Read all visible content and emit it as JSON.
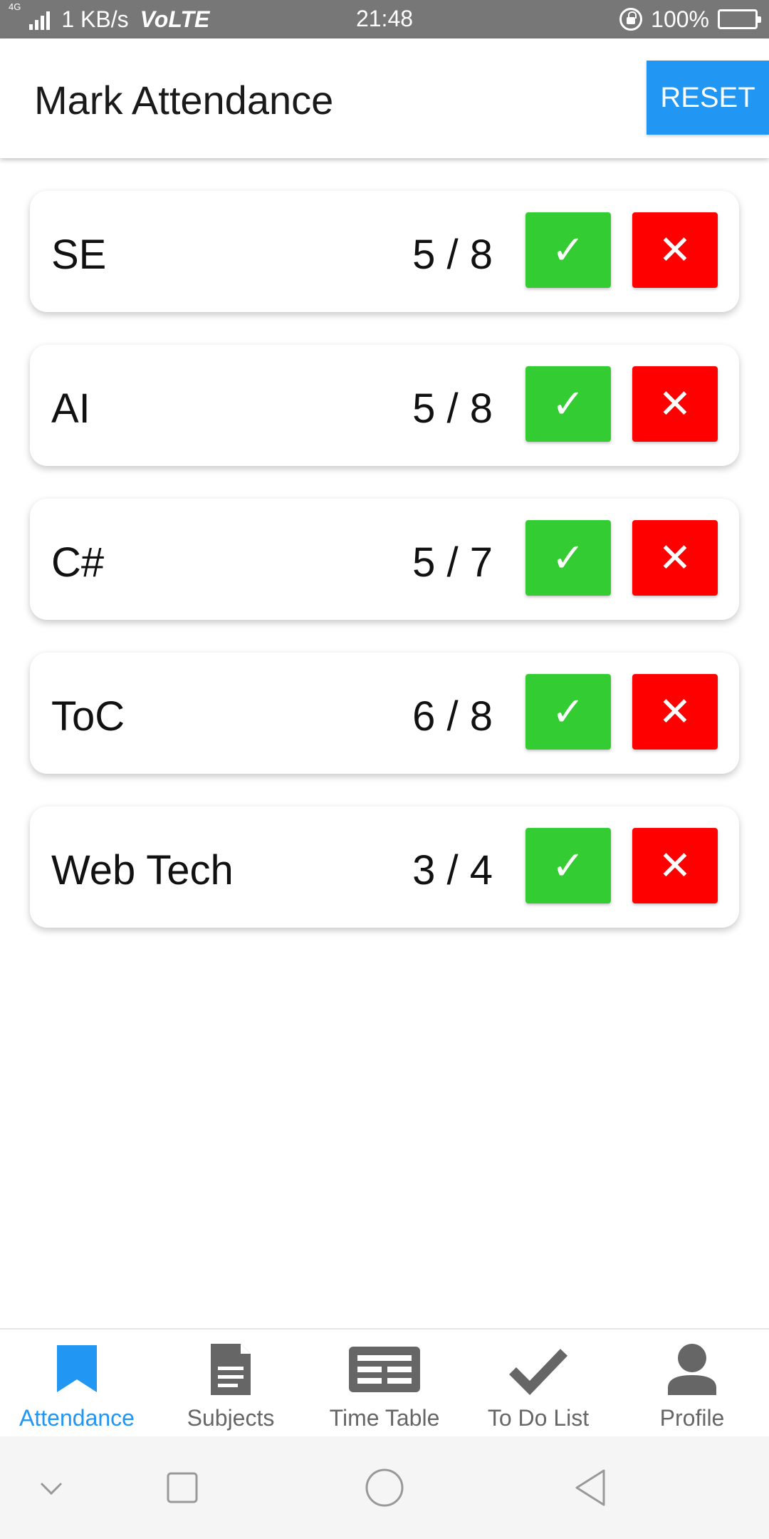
{
  "status_bar": {
    "network": "4G",
    "speed": "1 KB/s",
    "volte": "VoLTE",
    "time": "21:48",
    "battery": "100%"
  },
  "header": {
    "title": "Mark Attendance",
    "reset_label": "RESET"
  },
  "subjects": [
    {
      "name": "SE",
      "count": "5 / 8",
      "present_symbol": "✓",
      "absent_symbol": "✕"
    },
    {
      "name": "AI",
      "count": "5 / 8",
      "present_symbol": "✓",
      "absent_symbol": "✕"
    },
    {
      "name": "C#",
      "count": "5 / 7",
      "present_symbol": "✓",
      "absent_symbol": "✕"
    },
    {
      "name": "ToC",
      "count": "6 / 8",
      "present_symbol": "✓",
      "absent_symbol": "✕"
    },
    {
      "name": "Web Tech",
      "count": "3 / 4",
      "present_symbol": "✓",
      "absent_symbol": "✕"
    }
  ],
  "bottom_nav": [
    {
      "label": "Attendance",
      "icon": "bookmark-icon",
      "active": true
    },
    {
      "label": "Subjects",
      "icon": "document-icon",
      "active": false
    },
    {
      "label": "Time Table",
      "icon": "newspaper-icon",
      "active": false
    },
    {
      "label": "To Do List",
      "icon": "check-icon",
      "active": false
    },
    {
      "label": "Profile",
      "icon": "person-icon",
      "active": false
    }
  ],
  "colors": {
    "accent": "#2196F3",
    "present": "#33CC33",
    "absent": "#FF0000",
    "inactive_nav": "#666666"
  }
}
